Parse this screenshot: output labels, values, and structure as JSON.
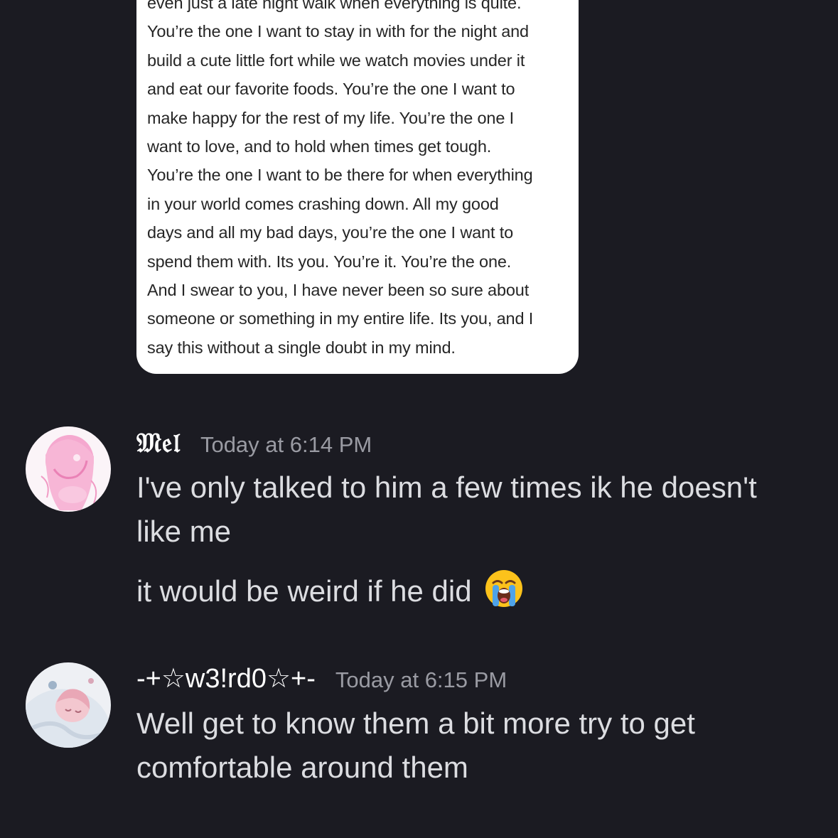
{
  "attachment": {
    "lines": [
      "even just a late night walk when everything is quite.",
      "You’re the one I want to stay in with for the night and",
      "build a cute little fort while we watch movies under it",
      "and eat our favorite foods. You’re the one I want to",
      "make happy for the rest of my life. You’re the one I",
      "want to love, and to hold when times get tough.",
      "You’re the one I want to be there for when everything",
      "in your world comes crashing down. All my good",
      "days and all my bad days, you’re the one I want to",
      "spend them with. Its you. You’re it. You’re the one.",
      "And I swear to you, I have never been so sure about",
      "someone or something in my entire life. Its you, and I",
      "say this without a single doubt in my mind."
    ]
  },
  "messages": [
    {
      "username": "𝔐𝔢𝔩",
      "timestamp": "Today at 6:14 PM",
      "lines": [
        "I've only talked to him a few times ik he doesn't",
        "like me"
      ],
      "followup": "it would be weird if he did",
      "followup_emoji": "loudly-crying-face-emoji"
    },
    {
      "username": "-+☆w3!rd0☆+-",
      "timestamp": "Today at 6:15 PM",
      "lines": [
        "Well get to know them a bit more try to get",
        "comfortable around them"
      ]
    }
  ],
  "colors": {
    "background": "#1b1b22",
    "message_text": "#dcdde1",
    "username": "#ffffff",
    "timestamp": "#9a9ba3"
  }
}
